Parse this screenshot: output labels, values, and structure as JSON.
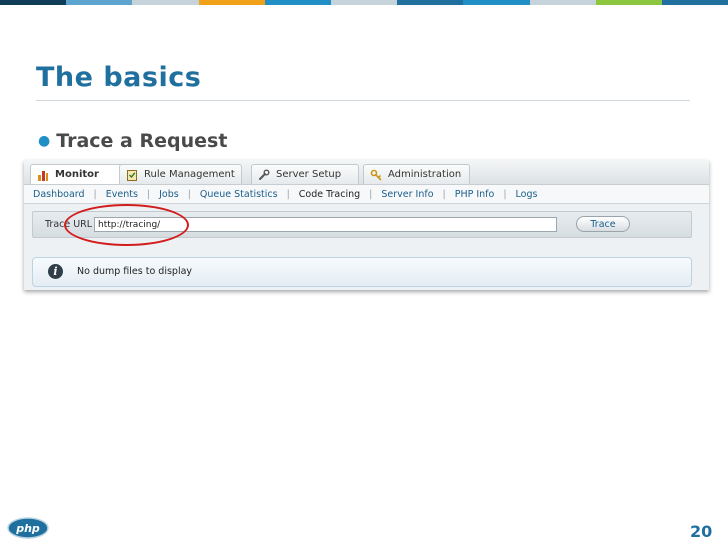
{
  "colors": {
    "accent": "#1f6f9f",
    "topbar": [
      "#0f3d57",
      "#5da4cf",
      "#c6d3da",
      "#f2a21a",
      "#1f8fc6",
      "#c6d3da",
      "#1f6f9f",
      "#1f8fc6",
      "#c6d3da",
      "#8cc63e",
      "#1f6f9f"
    ],
    "highlight": "#d21d1d"
  },
  "slide": {
    "title": "The basics",
    "bullet": "Trace a Request",
    "page_number": "20"
  },
  "screenshot": {
    "tabs": [
      {
        "label": "Monitor",
        "icon": "bar-chart-icon",
        "active": true
      },
      {
        "label": "Rule Management",
        "icon": "clipboard-icon",
        "active": false
      },
      {
        "label": "Server Setup",
        "icon": "wrench-icon",
        "active": false
      },
      {
        "label": "Administration",
        "icon": "key-icon",
        "active": false
      }
    ],
    "subnav": [
      "Dashboard",
      "Events",
      "Jobs",
      "Queue Statistics",
      "Code Tracing",
      "Server Info",
      "PHP Info",
      "Logs"
    ],
    "current_subnav": "Code Tracing",
    "trace": {
      "label": "Trace URL",
      "value": "http://tracing/",
      "button": "Trace"
    },
    "notice": {
      "icon": "info-icon",
      "text": "No dump files to display"
    }
  },
  "footer": {
    "logo_text": "php"
  }
}
